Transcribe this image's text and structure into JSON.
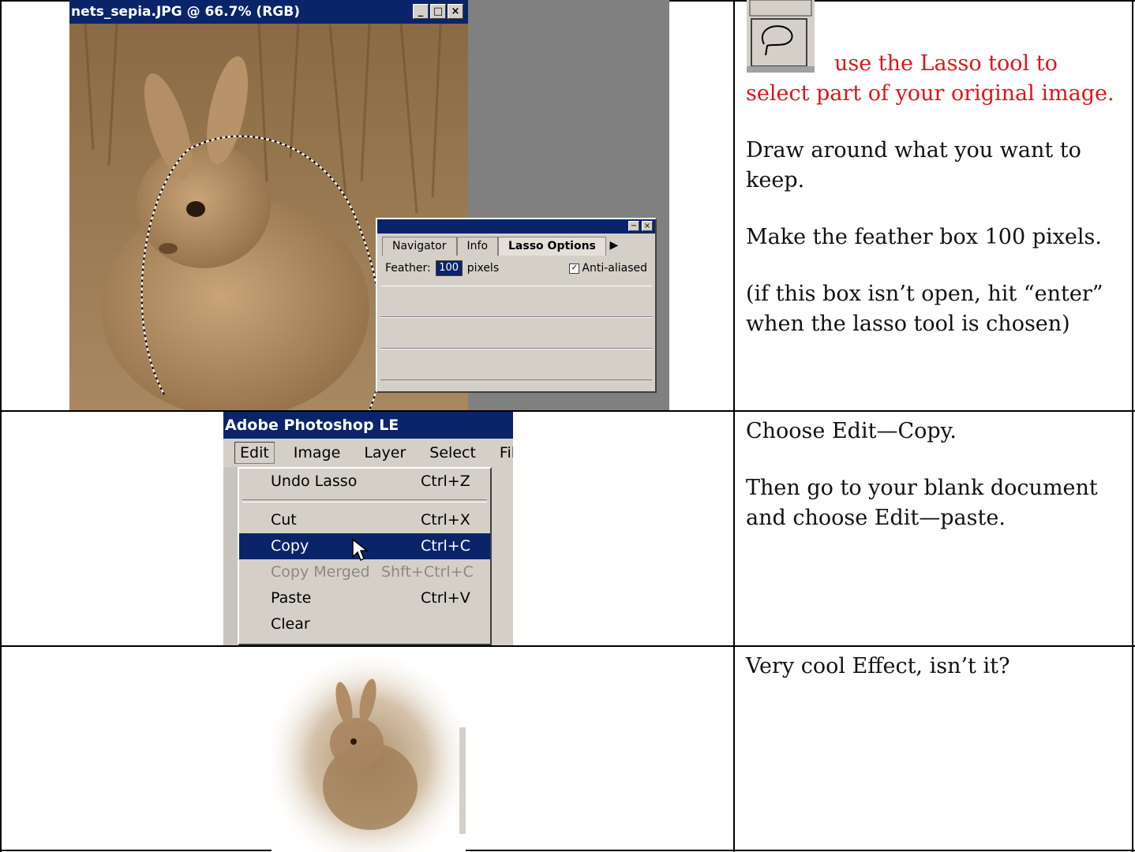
{
  "rows": [
    {
      "screenshot": {
        "document_title": "nets_sepia.JPG @ 66.7% (RGB)",
        "window_buttons": [
          "_",
          "□",
          "×"
        ],
        "panel": {
          "tabs": [
            "Navigator",
            "Info",
            "Lasso Options"
          ],
          "feather_label": "Feather:",
          "feather_value": "100",
          "feather_unit": "pixels",
          "anti_aliased_label": "Anti-aliased",
          "anti_aliased_checked": true
        }
      },
      "instruction_highlight": "use the Lasso tool to select part of your original image.",
      "instructions": [
        "Draw around what you want to keep.",
        "Make the feather box 100 pixels.",
        "(if this box isn’t open, hit “enter” when the lasso tool is chosen)"
      ]
    },
    {
      "screenshot": {
        "app_title": "Adobe Photoshop LE",
        "menubar": [
          "Edit",
          "Image",
          "Layer",
          "Select",
          "Filter"
        ],
        "open_menu": "Edit",
        "menu_items": [
          {
            "label": "Undo Lasso",
            "shortcut": "Ctrl+Z",
            "state": "normal"
          },
          {
            "label": "Cut",
            "shortcut": "Ctrl+X",
            "state": "normal"
          },
          {
            "label": "Copy",
            "shortcut": "Ctrl+C",
            "state": "selected"
          },
          {
            "label": "Copy Merged",
            "shortcut": "Shft+Ctrl+C",
            "state": "disabled"
          },
          {
            "label": "Paste",
            "shortcut": "Ctrl+V",
            "state": "normal"
          },
          {
            "label": "Clear",
            "shortcut": "",
            "state": "normal"
          }
        ]
      },
      "instructions": [
        "Choose Edit—Copy.",
        "Then go to your blank document and choose Edit—paste."
      ]
    },
    {
      "instructions": [
        "Very cool Effect, isn’t it?"
      ]
    }
  ],
  "colors": {
    "highlight_text": "#e0141c",
    "title_bar": "#0a246a",
    "win_face": "#d4d0c8",
    "sepia": "#9a7a52"
  }
}
